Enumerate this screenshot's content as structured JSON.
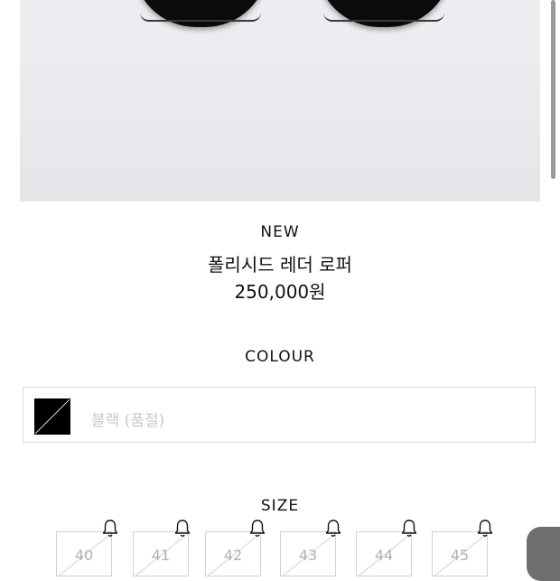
{
  "product": {
    "badge": "NEW",
    "name": "폴리시드 레더 로퍼",
    "price": "250,000원"
  },
  "colour": {
    "title": "COLOUR",
    "selected": "블랙 (품절)",
    "swatch_colors": [
      "#000000",
      "#ffffff"
    ]
  },
  "size": {
    "title": "SIZE",
    "options": [
      {
        "label": "40",
        "sold_out": true,
        "notify_icon": "bell-icon"
      },
      {
        "label": "41",
        "sold_out": true,
        "notify_icon": "bell-icon"
      },
      {
        "label": "42",
        "sold_out": true,
        "notify_icon": "bell-icon"
      },
      {
        "label": "43",
        "sold_out": true,
        "notify_icon": "bell-icon"
      },
      {
        "label": "44",
        "sold_out": true,
        "notify_icon": "bell-icon"
      },
      {
        "label": "45",
        "sold_out": true,
        "notify_icon": "bell-icon"
      }
    ]
  }
}
